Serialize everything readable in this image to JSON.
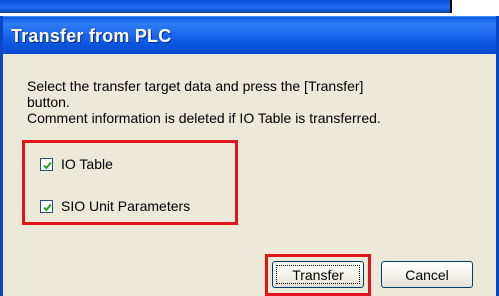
{
  "dialog": {
    "title": "Transfer from PLC",
    "message_line1": "Select the transfer target data and press the [Transfer]",
    "message_line2": "button.",
    "message_line3": "Comment information is deleted if IO Table is transferred.",
    "options": [
      {
        "label": "IO Table",
        "checked": true
      },
      {
        "label": "SIO Unit Parameters",
        "checked": true
      }
    ],
    "buttons": {
      "transfer": "Transfer",
      "cancel": "Cancel"
    }
  },
  "colors": {
    "titlebar": "#0a5fe8",
    "dialog_bg": "#ece9d8",
    "highlight": "#e3131c"
  },
  "icons": {
    "checkbox_checked": "check-mark-icon"
  }
}
